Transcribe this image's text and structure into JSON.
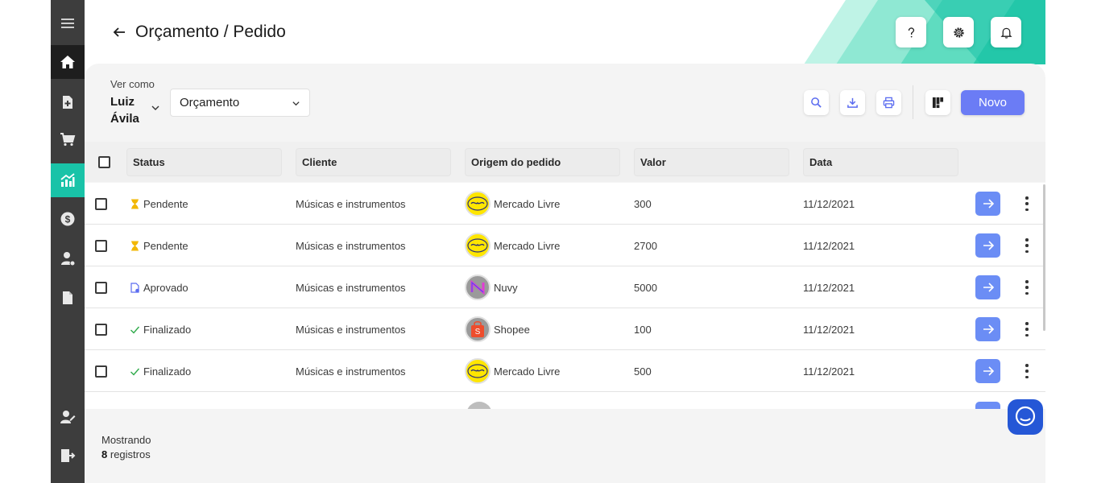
{
  "header": {
    "title": "Orçamento / Pedido"
  },
  "filters": {
    "view_as_label": "Ver como",
    "user_first": "Luiz",
    "user_last": "Ávila",
    "type_select": "Orçamento"
  },
  "toolbar": {
    "new_label": "Novo"
  },
  "table": {
    "columns": [
      "Status",
      "Cliente",
      "Origem do pedido",
      "Valor",
      "Data"
    ],
    "rows": [
      {
        "status": "Pendente",
        "status_icon": "hourglass-icon",
        "client": "Músicas e instrumentos",
        "origin": "Mercado Livre",
        "origin_icon": "mercado-livre-icon",
        "value": "300",
        "date": "11/12/2021"
      },
      {
        "status": "Pendente",
        "status_icon": "hourglass-icon",
        "client": "Músicas e instrumentos",
        "origin": "Mercado Livre",
        "origin_icon": "mercado-livre-icon",
        "value": "2700",
        "date": "11/12/2021"
      },
      {
        "status": "Aprovado",
        "status_icon": "document-check-icon",
        "client": "Músicas e instrumentos",
        "origin": "Nuvy",
        "origin_icon": "nuvy-icon",
        "value": "5000",
        "date": "11/12/2021"
      },
      {
        "status": "Finalizado",
        "status_icon": "check-icon",
        "client": "Músicas e instrumentos",
        "origin": "Shopee",
        "origin_icon": "shopee-icon",
        "value": "100",
        "date": "11/12/2021"
      },
      {
        "status": "Finalizado",
        "status_icon": "check-icon",
        "client": "Músicas e instrumentos",
        "origin": "Mercado Livre",
        "origin_icon": "mercado-livre-icon",
        "value": "500",
        "date": "11/12/2021"
      }
    ]
  },
  "footer": {
    "showing_label": "Mostrando",
    "count": "8",
    "records_label": "registros"
  },
  "colors": {
    "accent": "#6b7cf5",
    "sidebar": "#3d3d3d",
    "sidebar_active": "#19c3a8",
    "pending": "#f2b705",
    "approved": "#5b6cf0",
    "done": "#2eaa4a"
  },
  "sidebar": {
    "items": [
      "menu-icon",
      "home-icon",
      "add-document-icon",
      "cart-icon",
      "chart-icon",
      "dollar-icon",
      "user-settings-icon",
      "file-icon",
      "user-edit-icon",
      "logout-icon"
    ]
  }
}
